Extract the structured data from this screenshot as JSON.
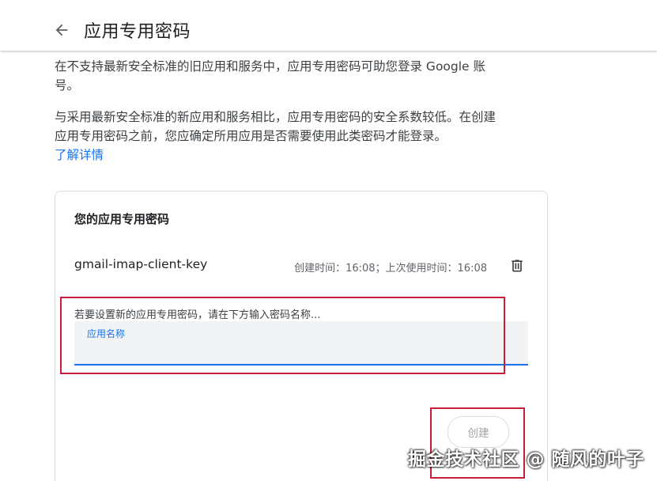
{
  "header": {
    "title": "应用专用密码",
    "back_icon": "arrow-left-icon"
  },
  "intro": {
    "paragraph1": "在不支持最新安全标准的旧应用和服务中，应用专用密码可助您登录 Google 账号。",
    "paragraph2": "与采用最新安全标准的新应用和服务相比，应用专用密码的安全系数较低。在创建应用专用密码之前，您应确定所用应用是否需要使用此类密码才能登录。",
    "learn_more": "了解详情"
  },
  "card": {
    "title": "您的应用专用密码",
    "passwords": [
      {
        "name": "gmail-imap-client-key",
        "meta": "创建时间：16:08；上次使用时间：16:08",
        "delete_icon": "trash-icon"
      }
    ],
    "hint": "若要设置新的应用专用密码，请在下方输入密码名称...",
    "input": {
      "label": "应用名称",
      "value": ""
    },
    "create_label": "创建"
  },
  "watermark": "掘金技术社区 @ 随风的叶子",
  "colors": {
    "accent": "#1a73e8",
    "annotation": "#c81e3a",
    "text_primary": "#202124",
    "text_secondary": "#5f6368"
  }
}
